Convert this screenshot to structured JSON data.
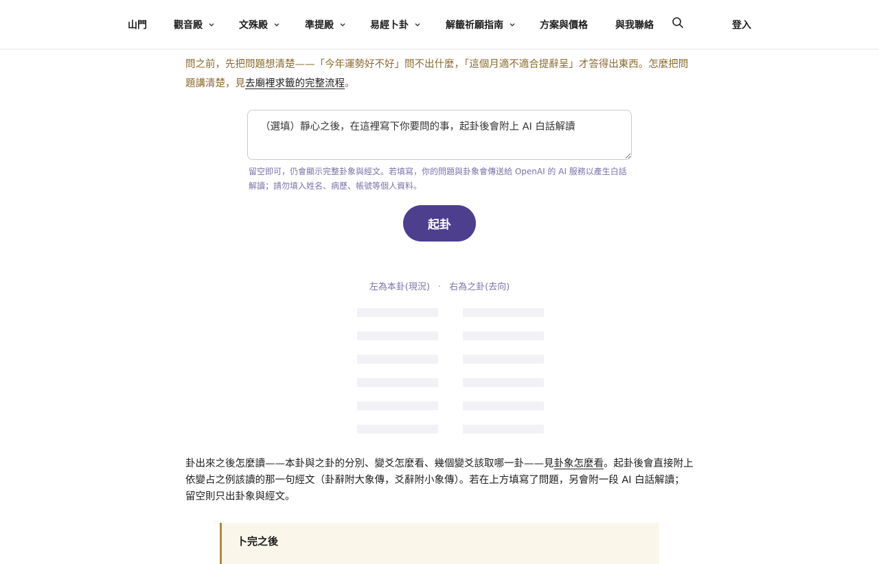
{
  "header": {
    "nav": [
      {
        "label": "山門",
        "has_dropdown": false
      },
      {
        "label": "觀音殿",
        "has_dropdown": true
      },
      {
        "label": "文殊殿",
        "has_dropdown": true
      },
      {
        "label": "準提殿",
        "has_dropdown": true
      },
      {
        "label": "易經卜卦",
        "has_dropdown": true
      },
      {
        "label": "解籤祈願指南",
        "has_dropdown": true
      },
      {
        "label": "方案與價格",
        "has_dropdown": false
      },
      {
        "label": "與我聯絡",
        "has_dropdown": false
      }
    ],
    "search_icon": "search-icon",
    "login_label": "登入"
  },
  "intro": {
    "text_before": "問之前，先把問題想清楚——「今年運勢好不好」問不出什麼，「這個月適不適合提辭呈」才答得出東西。怎麼把問題講清楚，見",
    "link": "去廟裡求籤的完整流程",
    "text_after": "。"
  },
  "question": {
    "value": "",
    "placeholder": "（選填）靜心之後，在這裡寫下你要問的事，起卦後會附上 AI 白話解讀"
  },
  "hint": "留空即可，仍會顯示完整卦象與經文。若填寫，你的問題與卦象會傳送給 OpenAI 的 AI 服務以產生白話解讀；請勿填入姓名、病歷、帳號等個人資料。",
  "cast_button": "起卦",
  "legend": {
    "left": "左為本卦(現況)",
    "sep": "·",
    "right": "右為之卦(去向)"
  },
  "explain": {
    "text_before": "卦出來之後怎麼讀——本卦與之卦的分別、變爻怎麼看、幾個變爻該取哪一卦——見",
    "link": "卦象怎麼看",
    "text_after": "。起卦後會直接附上依變占之例該讀的那一句經文（卦辭附大象傳，爻辭附小象傳）。若在上方填寫了問題，另會附一段 AI 白話解讀；留空則只出卦象與經文。"
  },
  "callout": {
    "title": "卜完之後"
  },
  "colors": {
    "accent": "#4e3f8e",
    "intro_text": "#8a6a2c",
    "hint_text": "#7b73a8",
    "callout_bg": "#fbf6ea",
    "callout_border": "#b08a3a"
  }
}
